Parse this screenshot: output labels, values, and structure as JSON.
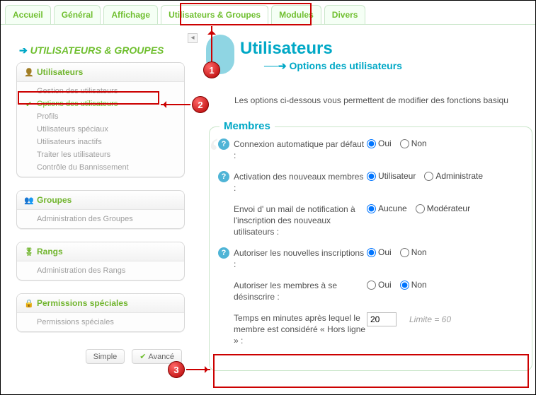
{
  "tabs": {
    "accueil": "Accueil",
    "general": "Général",
    "affichage": "Affichage",
    "users": "Utilisateurs & Groupes",
    "modules": "Modules",
    "divers": "Divers"
  },
  "sidebar": {
    "title": "UTILISATEURS & GROUPES",
    "sections": {
      "users": {
        "label": "Utilisateurs",
        "items": [
          "Gestion des utilisateurs",
          "Options des utilisateurs",
          "Profils",
          "Utilisateurs spéciaux",
          "Utilisateurs inactifs",
          "Traiter les utilisateurs",
          "Contrôle du Bannissement"
        ],
        "selected_index": 1
      },
      "groups": {
        "label": "Groupes",
        "items": [
          "Administration des Groupes"
        ]
      },
      "ranks": {
        "label": "Rangs",
        "items": [
          "Administration des Rangs"
        ]
      },
      "perms": {
        "label": "Permissions spéciales",
        "items": [
          "Permissions spéciales"
        ]
      }
    },
    "buttons": {
      "simple": "Simple",
      "advanced": "Avancé"
    }
  },
  "main": {
    "title": "Utilisateurs",
    "subtitle": "Options des utilisateurs",
    "intro": "Les options ci-dessous vous permettent de modifier des fonctions basiqu",
    "fieldset": {
      "legend": "Membres",
      "rows": {
        "autoconnect": {
          "label": "Connexion automatique par défaut :",
          "opt_yes": "Oui",
          "opt_no": "Non",
          "value": "yes"
        },
        "activation": {
          "label": "Activation des nouveaux membres :",
          "opt_user": "Utilisateur",
          "opt_admin": "Administrate",
          "value": "user"
        },
        "mail": {
          "label": "Envoi d' un mail de notification à l'inscription des nouveaux utilisateurs :",
          "opt_none": "Aucune",
          "opt_mod": "Modérateur",
          "value": "none"
        },
        "allow_reg": {
          "label": "Autoriser les nouvelles inscriptions :",
          "opt_yes": "Oui",
          "opt_no": "Non",
          "value": "yes"
        },
        "allow_unreg": {
          "label": "Autoriser les membres à se désinscrire :",
          "opt_yes": "Oui",
          "opt_no": "Non",
          "value": "no"
        },
        "offline_time": {
          "label": "Temps en minutes après lequel le membre est considéré « Hors ligne » :",
          "value": "20",
          "hint": "Limite = 60"
        }
      }
    }
  },
  "callouts": {
    "1": "1",
    "2": "2",
    "3": "3"
  }
}
